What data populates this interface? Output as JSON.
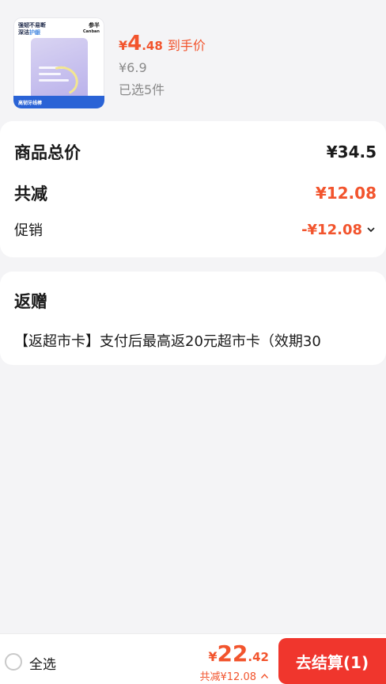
{
  "product": {
    "image_texts": {
      "headline_1": "强韧不易断",
      "headline_2": "深洁",
      "headline_highlight": "护龈",
      "brand_cn": "参半",
      "brand_en": "Canban",
      "band": "高韧牙线棒"
    },
    "price_yen": "¥",
    "price_int": "4",
    "price_dec": ".48",
    "price_tag": "到手价",
    "original_price": "¥6.9",
    "selected_count": "已选5件"
  },
  "summary": {
    "total_label": "商品总价",
    "total_value": "¥34.5",
    "discount_label": "共减",
    "discount_value": "¥12.08",
    "promo_label": "促销",
    "promo_value": "-¥12.08"
  },
  "gift": {
    "title": "返赠",
    "description": "【返超市卡】支付后最高返20元超市卡（效期30"
  },
  "bottom_bar": {
    "select_all": "全选",
    "total_yen": "¥",
    "total_int": "22",
    "total_dec": ".42",
    "saved_text": "共减¥12.08",
    "checkout_label": "去结算(1)"
  },
  "colors": {
    "accent_red": "#f2542d",
    "button_red": "#f0362d",
    "background": "#f4f4f6"
  },
  "icons": {
    "promo_toggle": "chevron-down-icon",
    "saved_toggle": "chevron-up-icon",
    "select_all": "radio-icon"
  }
}
